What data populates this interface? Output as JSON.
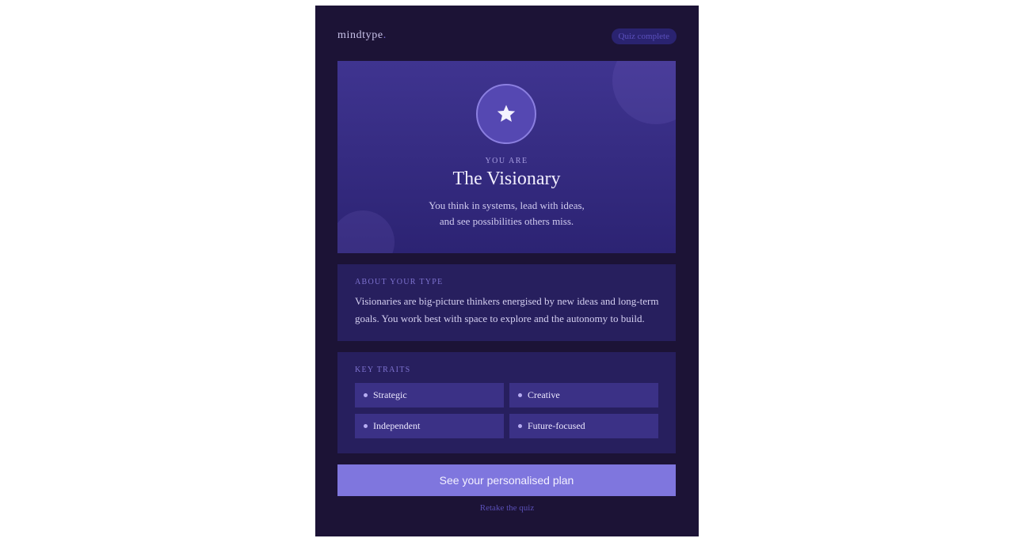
{
  "brand": {
    "name": "mindtype",
    "dot": "."
  },
  "header": {
    "status_badge": "Quiz complete"
  },
  "hero": {
    "icon": "star-icon",
    "eyebrow": "YOU ARE",
    "title": "The Visionary",
    "description_lines": [
      "You think in systems, lead with ideas,",
      "and see possibilities others miss."
    ]
  },
  "about": {
    "label": "ABOUT YOUR TYPE",
    "text_lines": [
      "Visionaries are big-picture thinkers energised by new ideas and long-term",
      "goals. You work best with space to explore and the autonomy to build."
    ]
  },
  "traits": {
    "label": "KEY TRAITS",
    "items": [
      "Strategic",
      "Creative",
      "Independent",
      "Future-focused"
    ]
  },
  "actions": {
    "primary_label": "See your personalised plan",
    "secondary_label": "Retake the quiz"
  },
  "colors": {
    "background": "#1c1336",
    "hero": "#3f3490",
    "card": "#271f5e",
    "accent": "#7f76de"
  }
}
